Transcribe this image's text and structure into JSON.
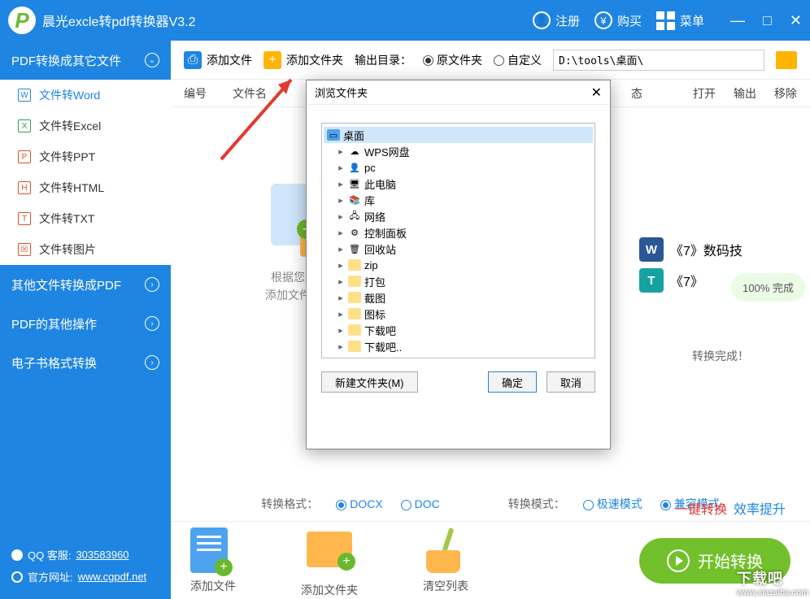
{
  "app": {
    "title": "晨光excle转pdf转换器V3.2"
  },
  "titlebar": {
    "register": "注册",
    "buy": "购买",
    "menu": "菜单"
  },
  "sidebar": {
    "sec1": "PDF转换成其它文件",
    "items": [
      {
        "label": "文件转Word",
        "ic": "W"
      },
      {
        "label": "文件转Excel",
        "ic": "X"
      },
      {
        "label": "文件转PPT",
        "ic": "P"
      },
      {
        "label": "文件转HTML",
        "ic": "H"
      },
      {
        "label": "文件转TXT",
        "ic": "T"
      },
      {
        "label": "文件转图片",
        "ic": "☒"
      }
    ],
    "sec2": "其他文件转换成PDF",
    "sec3": "PDF的其他操作",
    "sec4": "电子书格式转换"
  },
  "toolbar": {
    "addfile": "添加文件",
    "addfolder": "添加文件夹",
    "outdir": "输出目录：",
    "opt_source": "原文件夹",
    "opt_custom": "自定义",
    "path": "D:\\tools\\桌面\\"
  },
  "columns": {
    "no": "编号",
    "name": "文件名",
    "state": "态",
    "open": "打开",
    "out": "输出",
    "del": "移除"
  },
  "drop": {
    "l1": "根据您的需要",
    "l2": "添加文件或文件"
  },
  "right": {
    "row1_label": "《7》数码技",
    "row2_label": "《7》",
    "progress": "100%  完成",
    "done": "转换完成！"
  },
  "formats": {
    "fmt_lbl": "转换格式：",
    "docx": "DOCX",
    "doc": "DOC",
    "mode_lbl": "转换模式：",
    "fast": "极速模式",
    "compat": "兼容模式"
  },
  "bottom": {
    "addfile": "添加文件",
    "addfolder": "添加文件夹",
    "clear": "清空列表",
    "start": "开始转换"
  },
  "slogan": {
    "s1": "一键转换",
    "s2": "效率提升"
  },
  "footer": {
    "qq_lbl": "QQ 客服:",
    "qq": "303583960",
    "web_lbl": "官方网址:",
    "web": "www.cgpdf.net"
  },
  "dialog": {
    "title": "浏览文件夹",
    "root": "桌面",
    "nodes": [
      {
        "label": "WPS网盘",
        "ic": "cloud"
      },
      {
        "label": "pc",
        "ic": "user"
      },
      {
        "label": "此电脑",
        "ic": "pc"
      },
      {
        "label": "库",
        "ic": "lib"
      },
      {
        "label": "网络",
        "ic": "net"
      },
      {
        "label": "控制面板",
        "ic": "ctrl"
      },
      {
        "label": "回收站",
        "ic": "bin"
      },
      {
        "label": "zip",
        "ic": "folder"
      },
      {
        "label": "打包",
        "ic": "folder"
      },
      {
        "label": "截图",
        "ic": "folder"
      },
      {
        "label": "图标",
        "ic": "folder"
      },
      {
        "label": "下载吧",
        "ic": "folder"
      },
      {
        "label": "下载吧..",
        "ic": "folder"
      }
    ],
    "new": "新建文件夹(M)",
    "ok": "确定",
    "cancel": "取消"
  },
  "watermark": {
    "big": "下载吧",
    "sub": "www.xiazaiba.com"
  }
}
